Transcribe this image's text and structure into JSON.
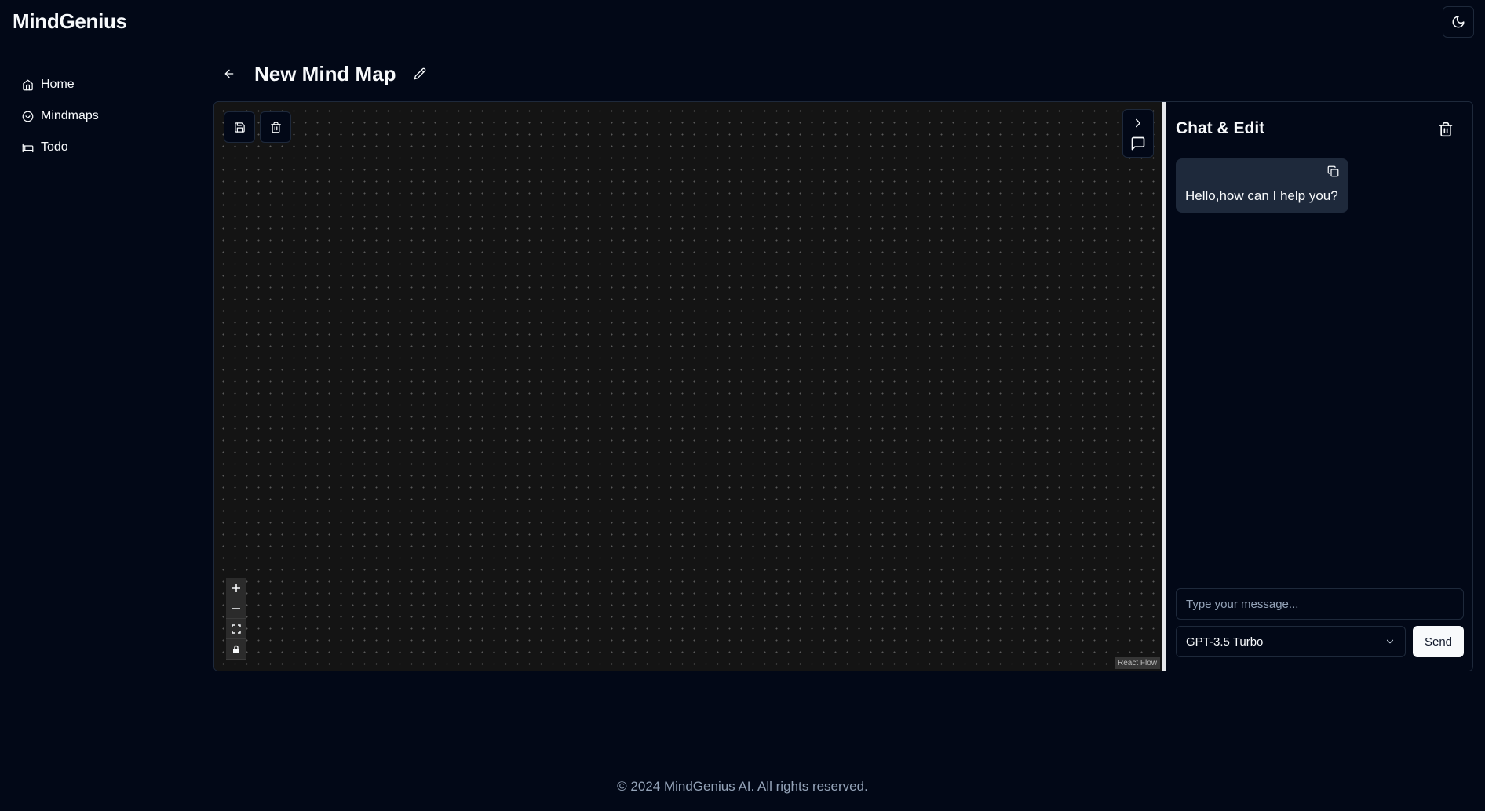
{
  "app": {
    "brand": "MindGenius"
  },
  "sidebar": {
    "items": [
      {
        "label": "Home",
        "icon": "home-icon"
      },
      {
        "label": "Mindmaps",
        "icon": "circle-chevron-icon"
      },
      {
        "label": "Todo",
        "icon": "bed-icon"
      }
    ]
  },
  "page": {
    "title": "New Mind Map"
  },
  "canvas": {
    "attribution": "React Flow"
  },
  "chat": {
    "title": "Chat & Edit",
    "messages": [
      {
        "text": "Hello,how can I help you?"
      }
    ],
    "input_placeholder": "Type your message...",
    "model": "GPT-3.5 Turbo",
    "send_label": "Send"
  },
  "footer": {
    "text": "© 2024 MindGenius AI. All rights reserved."
  },
  "colors": {
    "background": "#020817",
    "canvas": "#141414",
    "border": "#1e293b",
    "bubble": "#1e293b",
    "muted_text": "#94a3b8"
  }
}
